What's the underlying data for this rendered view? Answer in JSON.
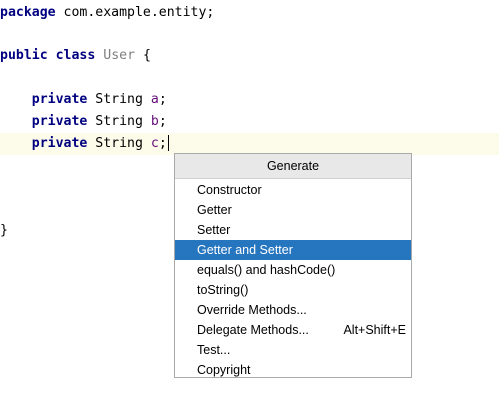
{
  "code": {
    "package_kw": "package",
    "package_name": " com.example.entity;",
    "public_kw": "public",
    "class_kw": "class",
    "class_name": "User",
    "open_brace": " {",
    "fields": [
      {
        "kw": "private",
        "type": " String ",
        "name": "a",
        "end": ";"
      },
      {
        "kw": "private",
        "type": " String ",
        "name": "b",
        "end": ";"
      },
      {
        "kw": "private",
        "type": " String ",
        "name": "c",
        "end": ";"
      }
    ],
    "close_brace": "}"
  },
  "generate_menu": {
    "title": "Generate",
    "items": [
      {
        "label": "Constructor",
        "shortcut": ""
      },
      {
        "label": "Getter",
        "shortcut": ""
      },
      {
        "label": "Setter",
        "shortcut": ""
      },
      {
        "label": "Getter and Setter",
        "shortcut": "",
        "selected": true
      },
      {
        "label": "equals() and hashCode()",
        "shortcut": ""
      },
      {
        "label": "toString()",
        "shortcut": ""
      },
      {
        "label": "Override Methods...",
        "shortcut": ""
      },
      {
        "label": "Delegate Methods...",
        "shortcut": "Alt+Shift+E"
      },
      {
        "label": "Test...",
        "shortcut": ""
      },
      {
        "label": "Copyright",
        "shortcut": ""
      }
    ]
  },
  "colors": {
    "keyword": "#000080",
    "field": "#660e7a",
    "class_name": "#808080",
    "selection": "#2675bf",
    "current_line": "#fdfbe9"
  }
}
